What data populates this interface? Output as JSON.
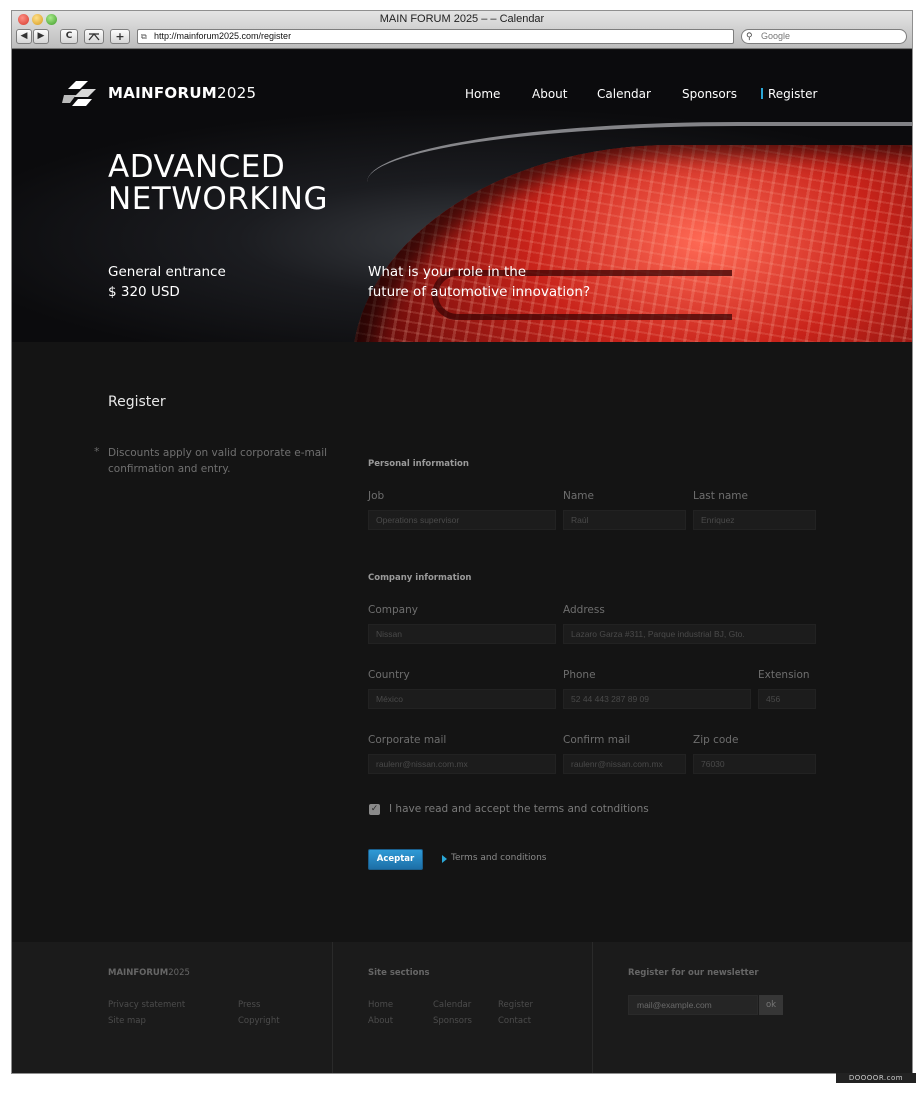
{
  "browser": {
    "title": "MAIN FORUM 2025 – – Calendar",
    "url": "http://mainforum2025.com/register",
    "search_placeholder": "Google",
    "back": "◀",
    "forward": "▶",
    "reload": "C",
    "add": "+"
  },
  "brand": {
    "logo_bold": "MAINFORUM",
    "logo_light": "2025"
  },
  "nav": {
    "home": "Home",
    "about": "About",
    "calendar": "Calendar",
    "sponsors": "Sponsors",
    "register": "Register"
  },
  "hero": {
    "line1": "ADVANCED",
    "line2": "NETWORKING",
    "price_label": "General entrance",
    "price_value": "$ 320 USD",
    "tagline_line1": "What is your role in the",
    "tagline_line2": "future of automotive innovation?"
  },
  "register": {
    "title": "Register",
    "note_star": "*",
    "note": "Discounts apply on valid corporate e-mail confirmation and entry."
  },
  "form": {
    "personal_title": "Personal information",
    "job_label": "Job",
    "job_placeholder": "Operations supervisor",
    "name_label": "Name",
    "name_placeholder": "Raúl",
    "lastname_label": "Last name",
    "lastname_placeholder": "Enriquez",
    "company_title": "Company information",
    "company_label": "Company",
    "company_placeholder": "Nissan",
    "address_label": "Address",
    "address_placeholder": "Lazaro Garza #311, Parque industrial BJ, Gto.",
    "country_label": "Country",
    "country_placeholder": "México",
    "phone_label": "Phone",
    "phone_placeholder": "52 44 443 287 89 09",
    "extension_label": "Extension",
    "extension_placeholder": "456",
    "mail_label": "Corporate mail",
    "mail_placeholder": "raulenr@nissan.com.mx",
    "confirm_label": "Confirm mail",
    "confirm_placeholder": "raulenr@nissan.com.mx",
    "zip_label": "Zip code",
    "zip_placeholder": "76030",
    "terms_check_label": "I have read and accept the terms and cotnditions",
    "terms_checked": "✓",
    "submit": "Aceptar",
    "terms_link": "Terms and conditions"
  },
  "footer": {
    "brand_bold": "MAINFORUM",
    "brand_light": "2025",
    "privacy": "Privacy statement",
    "press": "Press",
    "sitemap": "Site map",
    "copyright": "Copyright",
    "sections_title": "Site sections",
    "home": "Home",
    "calendar": "Calendar",
    "register": "Register",
    "about": "About",
    "sponsors": "Sponsors",
    "contact": "Contact",
    "newsletter_title": "Register for our newsletter",
    "newsletter_placeholder": "mail@example.com",
    "newsletter_button": "ok"
  },
  "watermark": "DOOOOR.com",
  "colors": {
    "accent": "#2aa7d6",
    "button": "#1d6fa7",
    "background": "#141414"
  }
}
